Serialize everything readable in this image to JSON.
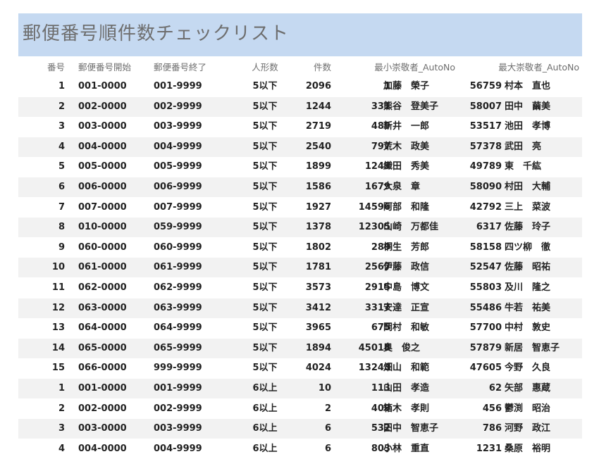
{
  "title": "郵便番号順件数チェックリスト",
  "headers": {
    "no": "番号",
    "start": "郵便番号開始",
    "end": "郵便番号終了",
    "people": "人形数",
    "count": "件数",
    "min": "最小崇敬者_AutoNo",
    "max": "最大崇敬者_AutoNo"
  },
  "rows": [
    {
      "no": "1",
      "start": "001-0000",
      "end": "001-9999",
      "people": "5以下",
      "count": "2096",
      "min_no": "1",
      "min_name": "加藤　榮子",
      "max_no": "56759",
      "max_name": "村本　直也"
    },
    {
      "no": "2",
      "start": "002-0000",
      "end": "002-9999",
      "people": "5以下",
      "count": "1244",
      "min_no": "331",
      "min_name": "熊谷　登美子",
      "max_no": "58007",
      "max_name": "田中　繭美"
    },
    {
      "no": "3",
      "start": "003-0000",
      "end": "003-9999",
      "people": "5以下",
      "count": "2719",
      "min_no": "489",
      "min_name": "新井　一郎",
      "max_no": "53517",
      "max_name": "池田　孝博"
    },
    {
      "no": "4",
      "start": "004-0000",
      "end": "004-9999",
      "people": "5以下",
      "count": "2540",
      "min_no": "797",
      "min_name": "荒木　政美",
      "max_no": "57378",
      "max_name": "武田　亮"
    },
    {
      "no": "5",
      "start": "005-0000",
      "end": "005-9999",
      "people": "5以下",
      "count": "1899",
      "min_no": "1243",
      "min_name": "織田　秀美",
      "max_no": "49789",
      "max_name": "東　千紘"
    },
    {
      "no": "6",
      "start": "006-0000",
      "end": "006-9999",
      "people": "5以下",
      "count": "1586",
      "min_no": "1679",
      "min_name": "大泉　章",
      "max_no": "58090",
      "max_name": "村田　大輔"
    },
    {
      "no": "7",
      "start": "007-0000",
      "end": "007-9999",
      "people": "5以下",
      "count": "1927",
      "min_no": "14596",
      "min_name": "阿部　和隆",
      "max_no": "42792",
      "max_name": "三上　菜波"
    },
    {
      "no": "8",
      "start": "010-0000",
      "end": "059-9999",
      "people": "5以下",
      "count": "1378",
      "min_no": "12305",
      "min_name": "山崎　万都佳",
      "max_no": "6317",
      "max_name": "佐藤　玲子"
    },
    {
      "no": "9",
      "start": "060-0000",
      "end": "060-9999",
      "people": "5以下",
      "count": "1802",
      "min_no": "289",
      "min_name": "桐生　芳郎",
      "max_no": "58158",
      "max_name": "四ツ柳　徹"
    },
    {
      "no": "10",
      "start": "061-0000",
      "end": "061-9999",
      "people": "5以下",
      "count": "1781",
      "min_no": "2567",
      "min_name": "伊藤　政信",
      "max_no": "52547",
      "max_name": "佐藤　昭祐"
    },
    {
      "no": "11",
      "start": "062-0000",
      "end": "062-9999",
      "people": "5以下",
      "count": "3573",
      "min_no": "2915",
      "min_name": "中島　博文",
      "max_no": "55803",
      "max_name": "及川　隆之"
    },
    {
      "no": "12",
      "start": "063-0000",
      "end": "063-9999",
      "people": "5以下",
      "count": "3412",
      "min_no": "3317",
      "min_name": "安達　正宣",
      "max_no": "55486",
      "max_name": "牛若　祐美"
    },
    {
      "no": "13",
      "start": "064-0000",
      "end": "064-9999",
      "people": "5以下",
      "count": "3965",
      "min_no": "675",
      "min_name": "岡村　和敏",
      "max_no": "57700",
      "max_name": "中村　敦史"
    },
    {
      "no": "14",
      "start": "065-0000",
      "end": "065-9999",
      "people": "5以下",
      "count": "1894",
      "min_no": "45018",
      "min_name": "奥　俊之",
      "max_no": "57879",
      "max_name": "新居　智恵子"
    },
    {
      "no": "15",
      "start": "066-0000",
      "end": "999-9999",
      "people": "5以下",
      "count": "4024",
      "min_no": "13243",
      "min_name": "畑山　和範",
      "max_no": "47605",
      "max_name": "今野　久良"
    },
    {
      "no": "1",
      "start": "001-0000",
      "end": "001-9999",
      "people": "6以上",
      "count": "10",
      "min_no": "113",
      "min_name": "山田　孝造",
      "max_no": "62",
      "max_name": "矢部　惠蔵"
    },
    {
      "no": "2",
      "start": "002-0000",
      "end": "002-9999",
      "people": "6以上",
      "count": "2",
      "min_no": "409",
      "min_name": "箱木　孝則",
      "max_no": "456",
      "max_name": "鬱渕　昭治"
    },
    {
      "no": "3",
      "start": "003-0000",
      "end": "003-9999",
      "people": "6以上",
      "count": "6",
      "min_no": "532",
      "min_name": "田中　智恵子",
      "max_no": "786",
      "max_name": "河野　政江"
    },
    {
      "no": "4",
      "start": "004-0000",
      "end": "004-9999",
      "people": "6以上",
      "count": "6",
      "min_no": "803",
      "min_name": "小林　重直",
      "max_no": "1231",
      "max_name": "桑原　裕明"
    }
  ]
}
